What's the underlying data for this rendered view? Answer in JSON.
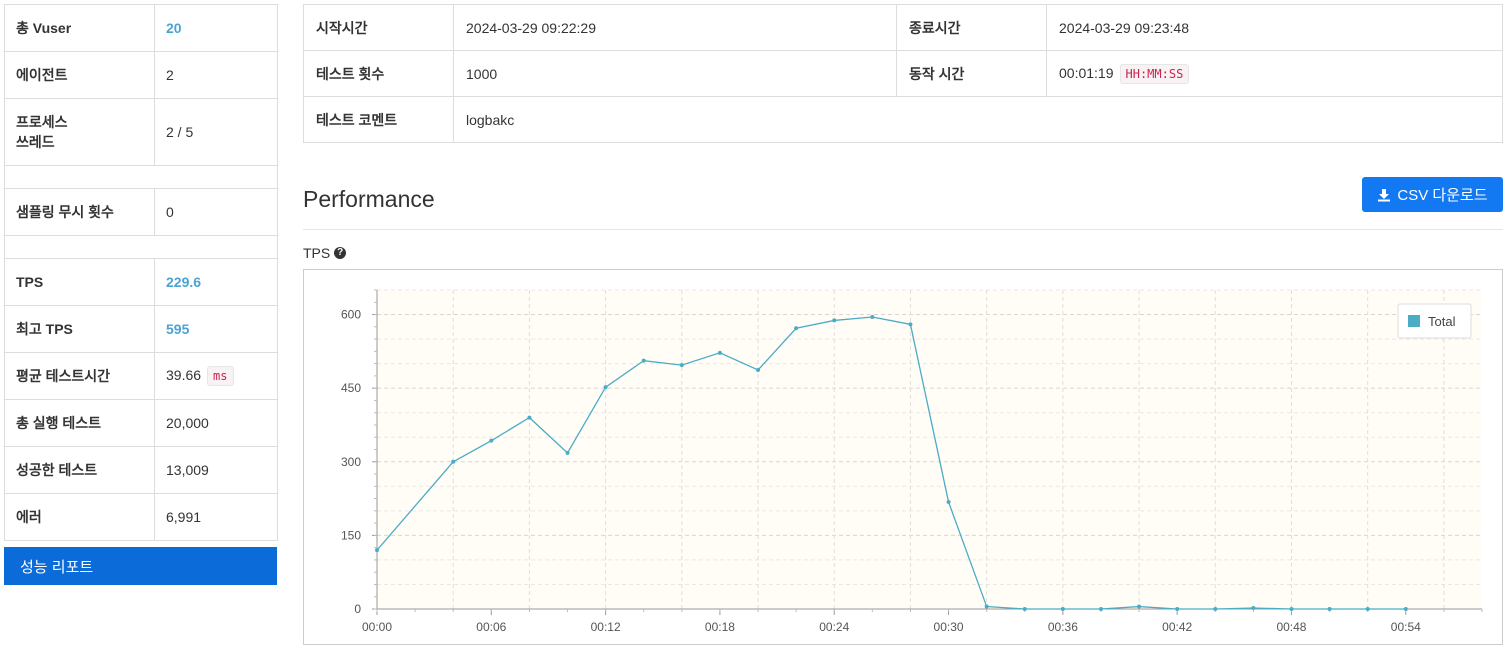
{
  "summary": {
    "rows": [
      {
        "label": "총 Vuser",
        "value": "20",
        "highlight": true
      },
      {
        "label": "에이전트",
        "value": "2"
      },
      {
        "label": "프로세스\n쓰레드",
        "value": "2 / 5"
      },
      {
        "spacer": true
      },
      {
        "label": "샘플링 무시 횟수",
        "value": "0"
      },
      {
        "spacer": true
      },
      {
        "label": "TPS",
        "value": "229.6",
        "highlight": true
      },
      {
        "label": "최고 TPS",
        "value": "595",
        "highlight": true
      },
      {
        "label": "평균 테스트시간",
        "value": "39.66",
        "unit": "ms"
      },
      {
        "label": "총 실행 테스트",
        "value": "20,000"
      },
      {
        "label": "성공한 테스트",
        "value": "13,009"
      },
      {
        "label": "에러",
        "value": "6,991"
      }
    ]
  },
  "report_button": "성능 리포트",
  "info": {
    "start_label": "시작시간",
    "start_value": "2024-03-29 09:22:29",
    "end_label": "종료시간",
    "end_value": "2024-03-29 09:23:48",
    "count_label": "테스트 횟수",
    "count_value": "1000",
    "duration_label": "동작 시간",
    "duration_value": "00:01:19",
    "duration_unit": "HH:MM:SS",
    "comment_label": "테스트 코멘트",
    "comment_value": "logbakc"
  },
  "performance": {
    "title": "Performance",
    "csv_button": "CSV 다운로드",
    "chart_label": "TPS"
  },
  "colors": {
    "accent": "#4aa3d3",
    "button": "#1279f2",
    "series": "#4bacc6",
    "plot_bg": "#fffdf6"
  },
  "chart_data": {
    "type": "line",
    "title": "",
    "xlabel": "",
    "ylabel": "",
    "ylim": [
      0,
      650
    ],
    "yticks": [
      0,
      150,
      300,
      450,
      600
    ],
    "xticks": [
      "00:00",
      "00:06",
      "00:12",
      "00:18",
      "00:24",
      "00:30",
      "00:36",
      "00:42",
      "00:48",
      "00:54"
    ],
    "x_unit_seconds_per_tick": 6,
    "xlim_seconds": [
      0,
      58
    ],
    "grid": true,
    "legend": "top-right",
    "series": [
      {
        "name": "Total",
        "x_seconds": [
          0,
          4,
          6,
          8,
          10,
          12,
          14,
          16,
          18,
          20,
          22,
          24,
          26,
          28,
          30,
          32,
          34,
          36,
          38,
          40,
          42,
          44,
          46,
          48,
          50,
          52,
          54
        ],
        "values": [
          120,
          300,
          343,
          390,
          318,
          452,
          506,
          497,
          522,
          487,
          572,
          588,
          595,
          580,
          218,
          5,
          0,
          0,
          0,
          5,
          0,
          0,
          2,
          0,
          0,
          0,
          0
        ]
      }
    ]
  }
}
